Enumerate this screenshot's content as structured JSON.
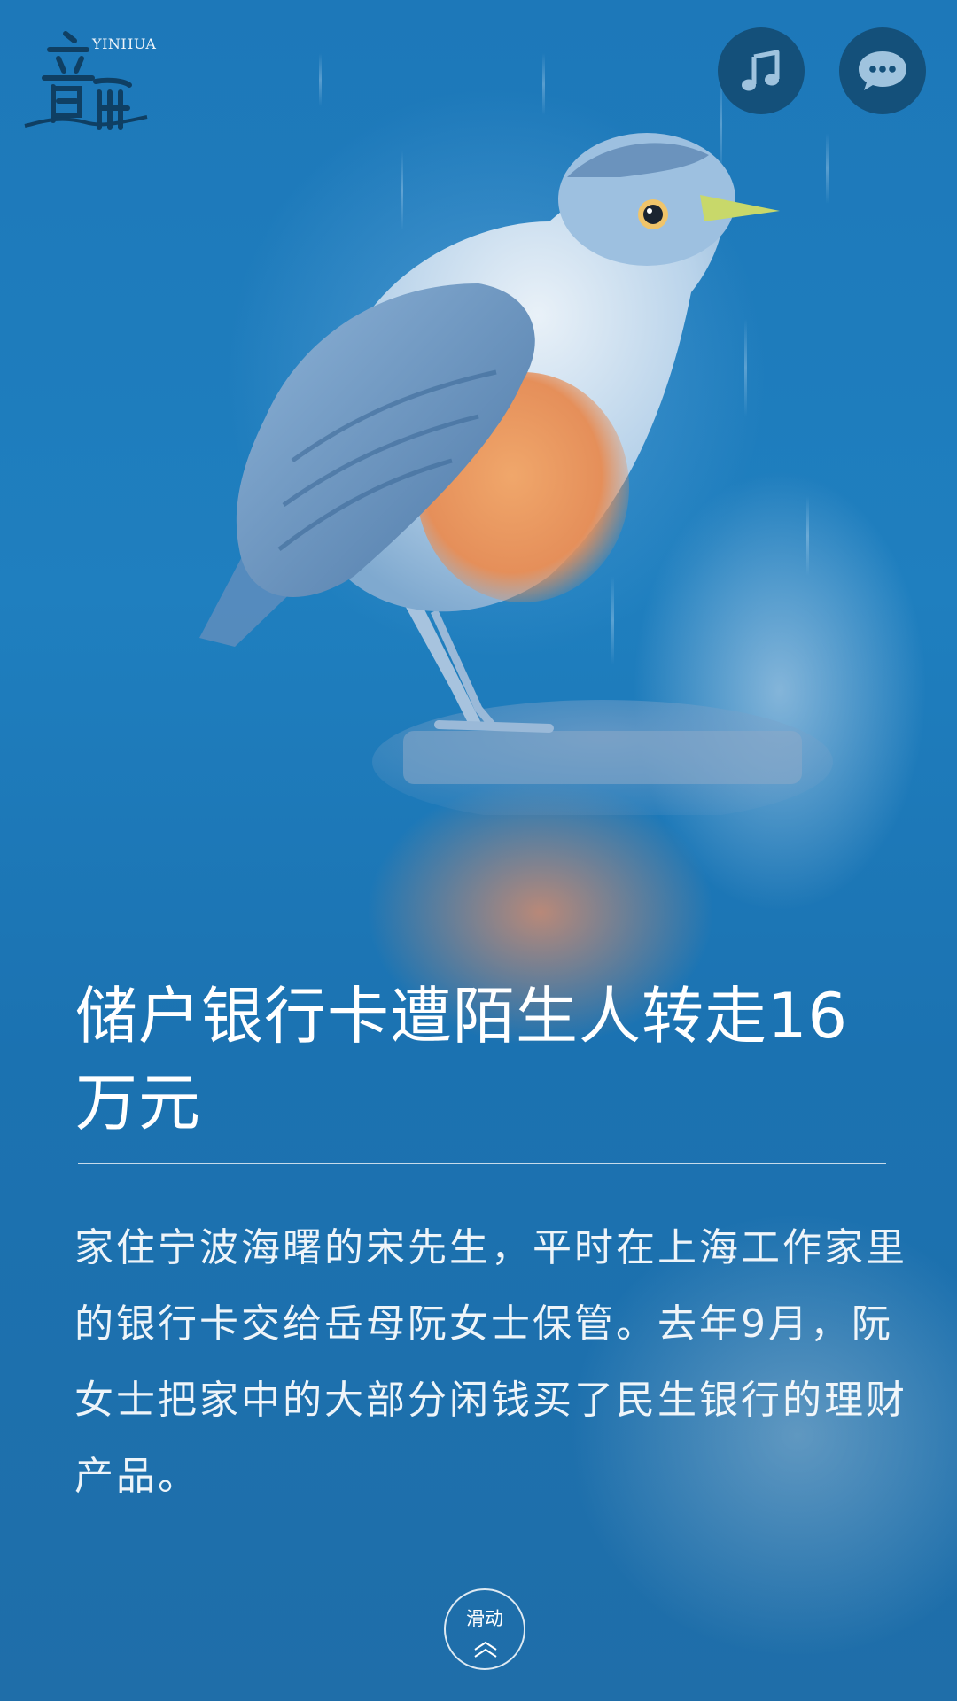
{
  "header": {
    "logo_text": "YINHUA",
    "logo_icon": "yinhua-calligraphy-logo",
    "music_button_icon": "music-note-icon",
    "comment_button_icon": "chat-bubble-icon"
  },
  "article": {
    "title": "储户银行卡遭陌生人转走16万元",
    "body": "家住宁波海曙的宋先生，平时在上海工作家里的银行卡交给岳母阮女士保管。去年9月，阮女士把家中的大部分闲钱买了民生银行的理财产品。"
  },
  "footer": {
    "scroll_label": "滑动",
    "scroll_icon": "double-chevron-up-icon"
  },
  "colors": {
    "background": "#1d78b9",
    "button_fill": "#14507a",
    "text": "#ffffff"
  }
}
